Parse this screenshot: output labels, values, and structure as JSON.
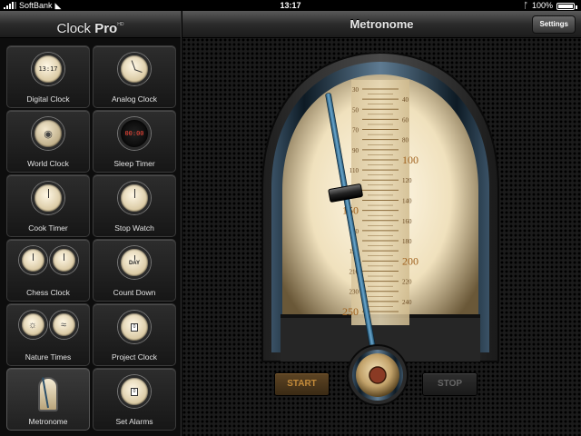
{
  "status_bar": {
    "carrier": "SoftBank",
    "time": "13:17",
    "battery": "100%"
  },
  "sidebar": {
    "app_title": "Clock",
    "app_title_pro": "Pro",
    "app_title_sup": "HD",
    "items": [
      {
        "label": "Digital Clock",
        "icon": "digital-clock-icon",
        "display": "13:17"
      },
      {
        "label": "Analog Clock",
        "icon": "analog-clock-icon"
      },
      {
        "label": "World Clock",
        "icon": "globe-icon"
      },
      {
        "label": "Sleep Timer",
        "icon": "sleep-timer-icon",
        "display": "00:00"
      },
      {
        "label": "Cook Timer",
        "icon": "cook-timer-icon"
      },
      {
        "label": "Stop Watch",
        "icon": "stopwatch-icon"
      },
      {
        "label": "Chess Clock",
        "icon": "chess-clock-icon"
      },
      {
        "label": "Count Down",
        "icon": "count-down-icon",
        "display": "DAY"
      },
      {
        "label": "Nature Times",
        "icon": "nature-times-icon"
      },
      {
        "label": "Project Clock",
        "icon": "project-clock-icon",
        "display": "0"
      },
      {
        "label": "Metronome",
        "icon": "metronome-icon"
      },
      {
        "label": "Set Alarms",
        "icon": "alarm-icon",
        "display": "0"
      }
    ],
    "selected": "Metronome"
  },
  "main": {
    "title": "Metronome",
    "settings_label": "Settings",
    "start_label": "START",
    "stop_label": "STOP"
  },
  "metronome": {
    "scale_left": [
      30,
      50,
      70,
      90,
      110,
      130,
      150,
      170,
      190,
      210,
      230,
      250
    ],
    "scale_right": [
      40,
      60,
      80,
      100,
      120,
      140,
      160,
      180,
      200,
      220,
      240
    ],
    "major_marks": [
      100,
      150,
      200,
      250
    ],
    "tempo_bpm": 130,
    "colors": {
      "accent_brown": "#c28a3a",
      "pendulum_blue": "#2d6a8c",
      "face_cream": "#f5ead0"
    }
  }
}
